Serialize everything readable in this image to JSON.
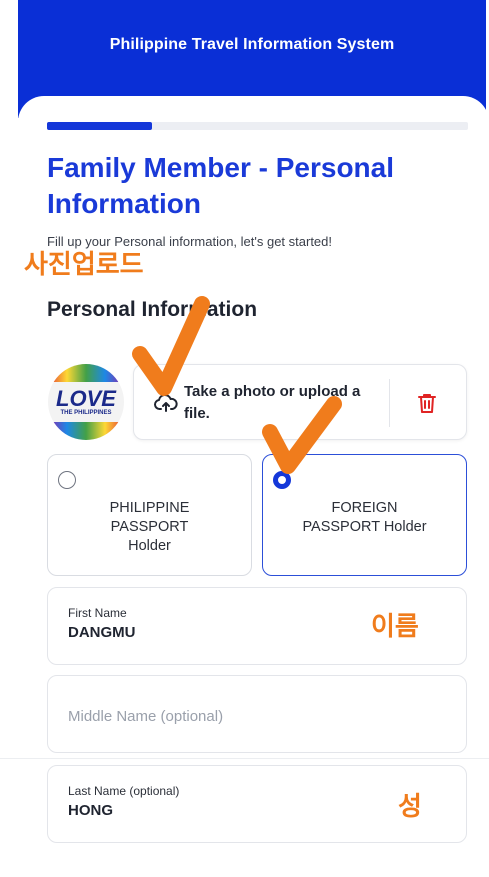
{
  "header": {
    "title": "Philippine Travel Information System"
  },
  "progress": {
    "fraction": 0.25
  },
  "page": {
    "title": "Family Member - Personal Information",
    "subtitle": "Fill up your Personal information, let's get started!",
    "section_title": "Personal Information"
  },
  "annotations": {
    "photo_upload": "사진업로드",
    "first_name": "이름",
    "last_name": "성"
  },
  "logo": {
    "text": "LOVE",
    "subtext": "THE PHILIPPINES"
  },
  "upload": {
    "label": "Take a photo or upload a file."
  },
  "passport": {
    "options": [
      {
        "label": "PHILIPPINE PASSPORT Holder",
        "selected": false
      },
      {
        "label": "FOREIGN PASSPORT Holder",
        "selected": true
      }
    ]
  },
  "fields": {
    "first_name": {
      "label": "First Name",
      "value": "DANGMU"
    },
    "middle_name": {
      "placeholder": "Middle Name (optional)"
    },
    "last_name": {
      "label": "Last Name (optional)",
      "value": "HONG"
    }
  },
  "icons": {
    "upload": "cloud-upload-icon",
    "delete": "trash-icon",
    "check": "checkmark-icon"
  },
  "colors": {
    "brand_blue": "#0a2fd6",
    "annotation_orange": "#f07c1c",
    "delete_red": "#e02424"
  }
}
